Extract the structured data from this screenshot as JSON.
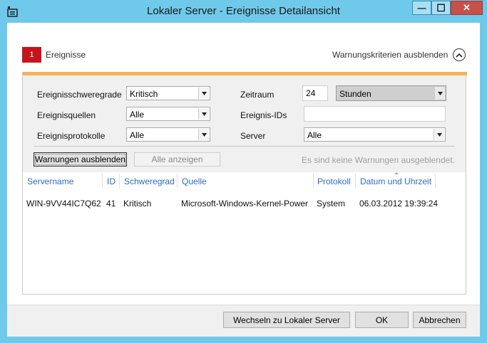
{
  "window": {
    "title": "Lokaler Server - Ereignisse Detailansicht",
    "minimize_glyph": "—",
    "maximize_glyph": "☐",
    "close_glyph": "✕"
  },
  "header": {
    "count": "1",
    "label": "Ereignisse",
    "toggle_label": "Warnungskriterien ausblenden",
    "toggle_icon": "chevron-up-icon"
  },
  "criteria": {
    "severity_label": "Ereignisschweregrade",
    "severity_value": "Kritisch",
    "sources_label": "Ereignisquellen",
    "sources_value": "Alle",
    "logs_label": "Ereignisprotokolle",
    "logs_value": "Alle",
    "period_label": "Zeitraum",
    "period_value": "24",
    "period_unit": "Stunden",
    "event_ids_label": "Ereignis-IDs",
    "event_ids_value": "",
    "server_label": "Server",
    "server_value": "Alle"
  },
  "actions": {
    "hide_warnings": "Warnungen ausblenden",
    "show_all": "Alle anzeigen",
    "status": "Es sind keine Warnungen ausgeblendet."
  },
  "table": {
    "columns": [
      "Servername",
      "ID",
      "Schweregrad",
      "Quelle",
      "Protokoll",
      "Datum und Uhrzeit"
    ],
    "rows": [
      [
        "WIN-9VV44IC7Q62",
        "41",
        "Kritisch",
        "Microsoft-Windows-Kernel-Power",
        "System",
        "06.03.2012 19:39:24"
      ]
    ]
  },
  "footer": {
    "switch_label": "Wechseln zu Lokaler Server",
    "ok_label": "OK",
    "cancel_label": "Abbrechen"
  },
  "colors": {
    "titlebar": "#6fc9ea",
    "badge": "#c4151c",
    "accent_bar": "#f3b35a",
    "column_header": "#2a6ebb",
    "close_button": "#c7504a"
  }
}
